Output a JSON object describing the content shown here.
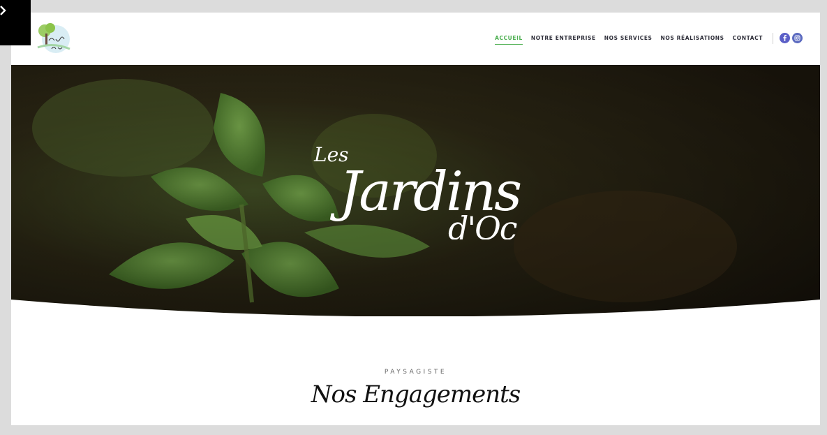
{
  "header": {
    "nav": [
      {
        "label": "ACCUEIL",
        "active": true
      },
      {
        "label": "NOTRE ENTREPRISE",
        "active": false
      },
      {
        "label": "NOS SERVICES",
        "active": false
      },
      {
        "label": "NOS RÉALISATIONS",
        "active": false
      },
      {
        "label": "CONTACT",
        "active": false
      }
    ],
    "social": [
      {
        "icon": "facebook-icon"
      },
      {
        "icon": "instagram-icon"
      }
    ]
  },
  "hero": {
    "title_line1": "Les",
    "title_line2": "Jardins",
    "title_line3": "d'Oc"
  },
  "section": {
    "eyebrow": "PAYSAGISTE",
    "title": "Nos Engagements"
  },
  "colors": {
    "accent": "#4caf50",
    "nav_text": "#2f2f3a",
    "social": "#5b5fc7"
  }
}
